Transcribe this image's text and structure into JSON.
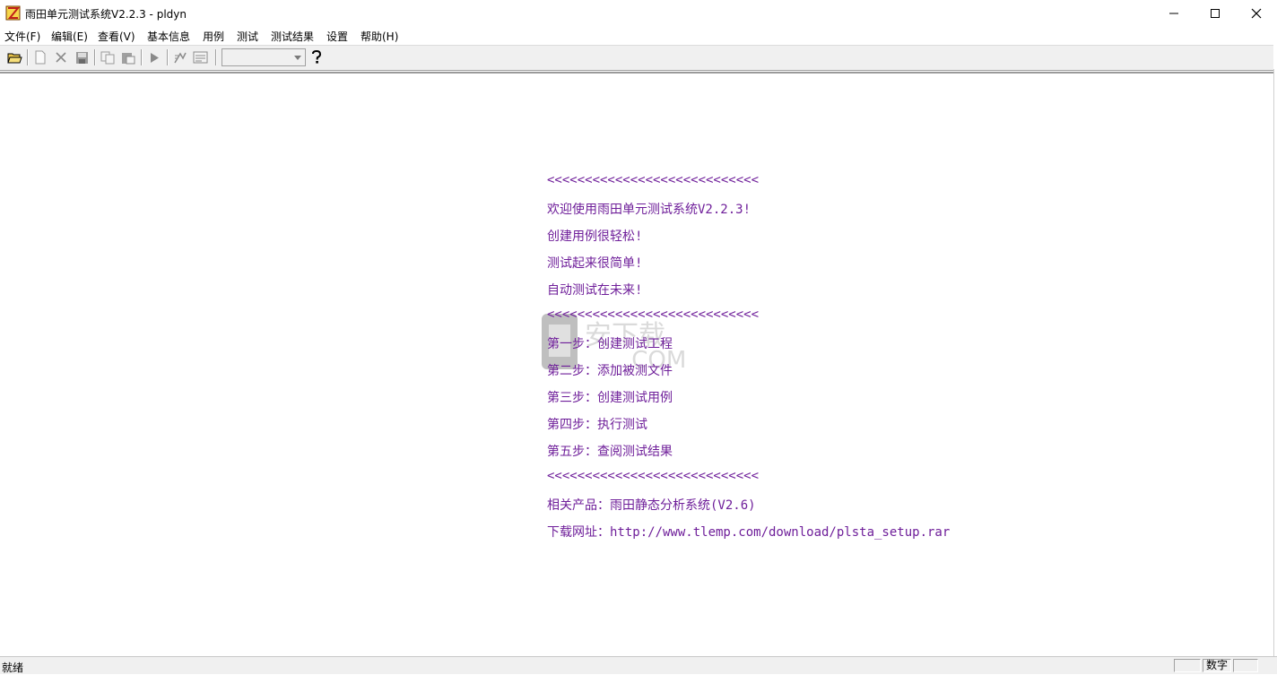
{
  "window": {
    "title": "雨田单元测试系统V2.2.3 - pldyn",
    "controls": [
      "minimize-icon",
      "maximize-icon",
      "close-icon"
    ]
  },
  "menu": {
    "items": [
      "文件(F)",
      "编辑(E)",
      "查看(V)",
      "基本信息",
      "用例",
      "测试",
      "测试结果",
      "设置",
      "帮助(H)"
    ]
  },
  "toolbar": {
    "buttons": [
      "open-folder-icon",
      "new-file-icon",
      "delete-icon",
      "save-icon",
      "copy-icon",
      "paste-icon",
      "run-icon",
      "step-icon",
      "view-icon",
      "help-icon"
    ],
    "combo_value": ""
  },
  "content": {
    "lines": [
      "<<<<<<<<<<<<<<<<<<<<<<<<<<<<",
      "欢迎使用雨田单元测试系统V2.2.3!",
      "创建用例很轻松!",
      "测试起来很简单!",
      "自动测试在未来!",
      "<<<<<<<<<<<<<<<<<<<<<<<<<<<<",
      "第一步：创建测试工程",
      "第二步：添加被测文件",
      "第三步：创建测试用例",
      "第四步：执行测试",
      "第五步：查阅测试结果",
      "<<<<<<<<<<<<<<<<<<<<<<<<<<<<",
      "相关产品：雨田静态分析系统(V2.6)",
      "下载网址：http://www.tlemp.com/download/plsta_setup.rar"
    ],
    "text_color": "#6f1f9a"
  },
  "statusbar": {
    "ready": "就绪",
    "num": "数字"
  }
}
